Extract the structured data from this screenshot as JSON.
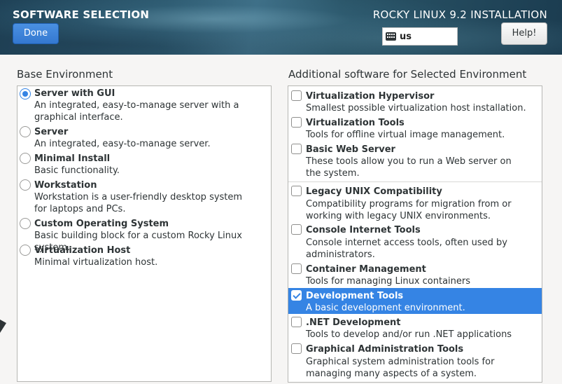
{
  "header": {
    "title": "SOFTWARE SELECTION",
    "done_label": "Done",
    "product": "ROCKY LINUX 9.2 INSTALLATION",
    "keyboard_layout": "us",
    "help_label": "Help!"
  },
  "base_environment": {
    "label": "Base Environment",
    "items": [
      {
        "name": "Server with GUI",
        "desc": "An integrated, easy-to-manage server with a graphical interface.",
        "selected": true
      },
      {
        "name": "Server",
        "desc": "An integrated, easy-to-manage server.",
        "selected": false
      },
      {
        "name": "Minimal Install",
        "desc": "Basic functionality.",
        "selected": false
      },
      {
        "name": "Workstation",
        "desc": "Workstation is a user-friendly desktop system for laptops and PCs.",
        "selected": false
      },
      {
        "name": "Custom Operating System",
        "desc": "Basic building block for a custom Rocky Linux system.",
        "selected": false
      },
      {
        "name": "Virtualization Host",
        "desc": "Minimal virtualization host.",
        "selected": false
      }
    ]
  },
  "additional_software": {
    "label": "Additional software for Selected Environment",
    "items": [
      {
        "name": "Virtualization Hypervisor",
        "desc": "Smallest possible virtualization host installation.",
        "checked": false
      },
      {
        "name": "Virtualization Tools",
        "desc": "Tools for offline virtual image management.",
        "checked": false
      },
      {
        "name": "Basic Web Server",
        "desc": "These tools allow you to run a Web server on the system.",
        "checked": false
      },
      {
        "name": "Legacy UNIX Compatibility",
        "desc": "Compatibility programs for migration from or working with legacy UNIX environments.",
        "checked": false
      },
      {
        "name": "Console Internet Tools",
        "desc": "Console internet access tools, often used by administrators.",
        "checked": false
      },
      {
        "name": "Container Management",
        "desc": "Tools for managing Linux containers",
        "checked": false
      },
      {
        "name": "Development Tools",
        "desc": "A basic development environment.",
        "checked": true
      },
      {
        "name": ".NET Development",
        "desc": "Tools to develop and/or run .NET applications",
        "checked": false
      },
      {
        "name": "Graphical Administration Tools",
        "desc": "Graphical system administration tools for managing many aspects of a system.",
        "checked": false
      }
    ]
  },
  "colors": {
    "accent": "#3584e4",
    "background": "#f6f5f4"
  },
  "icons": {
    "keyboard": "keyboard-icon"
  }
}
